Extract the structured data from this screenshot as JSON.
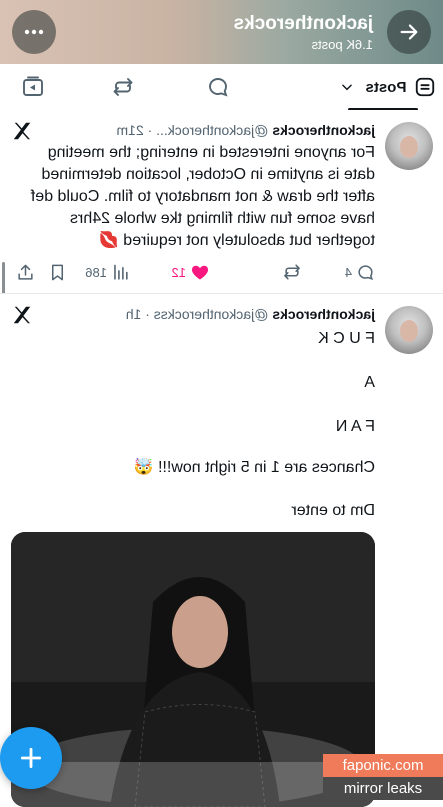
{
  "header": {
    "name": "jackontherocks",
    "post_count": "1.6K posts",
    "back_icon": "arrow-right-icon",
    "more_icon": "more-dots-icon"
  },
  "tabs": {
    "active_label": "Posts"
  },
  "tweets": [
    {
      "name": "jackontherocks",
      "handle_time": "@jackontherock... · 21m",
      "text": "For anyone interested in entering; the meeting date is anytime in October, location determined after the draw & not mandatory to film. Could def have some fun with filming tke whole 24hrs together but absolutely not required 💋",
      "replies": "4",
      "likes": "12",
      "views": "186"
    },
    {
      "name": "jackontherocks",
      "handle_time": "@jackontherockss · 1h",
      "lines": [
        "F U C K",
        "A",
        "F A N",
        "Chances are 1 in 5 right now!!! 🤯",
        "Dm to enter"
      ]
    }
  ],
  "watermark": {
    "line1": "faponic.com",
    "line2": "mirror leaks"
  },
  "colors": {
    "accent": "#1d9bf0",
    "like": "#f91880",
    "watermark_top": "#f07b5a",
    "watermark_bottom": "#4a4a4a"
  }
}
